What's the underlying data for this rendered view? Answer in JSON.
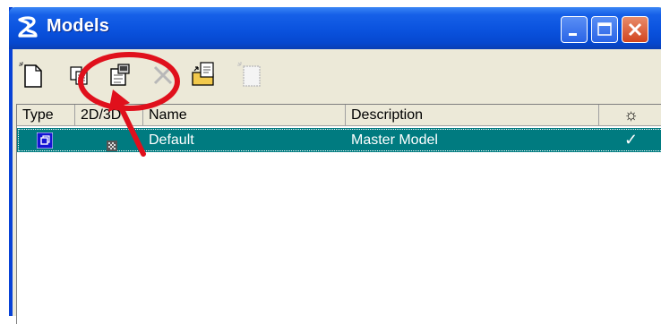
{
  "window": {
    "title": "Models"
  },
  "toolbar": {
    "tools": [
      "new-model-icon",
      "copy-model-icon",
      "edit-model-properties-icon",
      "delete-model-icon",
      "import-model-icon",
      "create-model-from-file-icon"
    ]
  },
  "list": {
    "columns": {
      "type": "Type",
      "dim": "2D/3D",
      "name": "Name",
      "description": "Description",
      "active": "☼"
    },
    "rows": [
      {
        "type_icon": "model-type-icon",
        "dim_icon": "3d-icon",
        "name": "Default",
        "description": "Master Model",
        "active": "✓"
      }
    ]
  },
  "colors": {
    "accent": "#0a52de",
    "selection": "#007b80",
    "annotation": "#e0101c"
  }
}
